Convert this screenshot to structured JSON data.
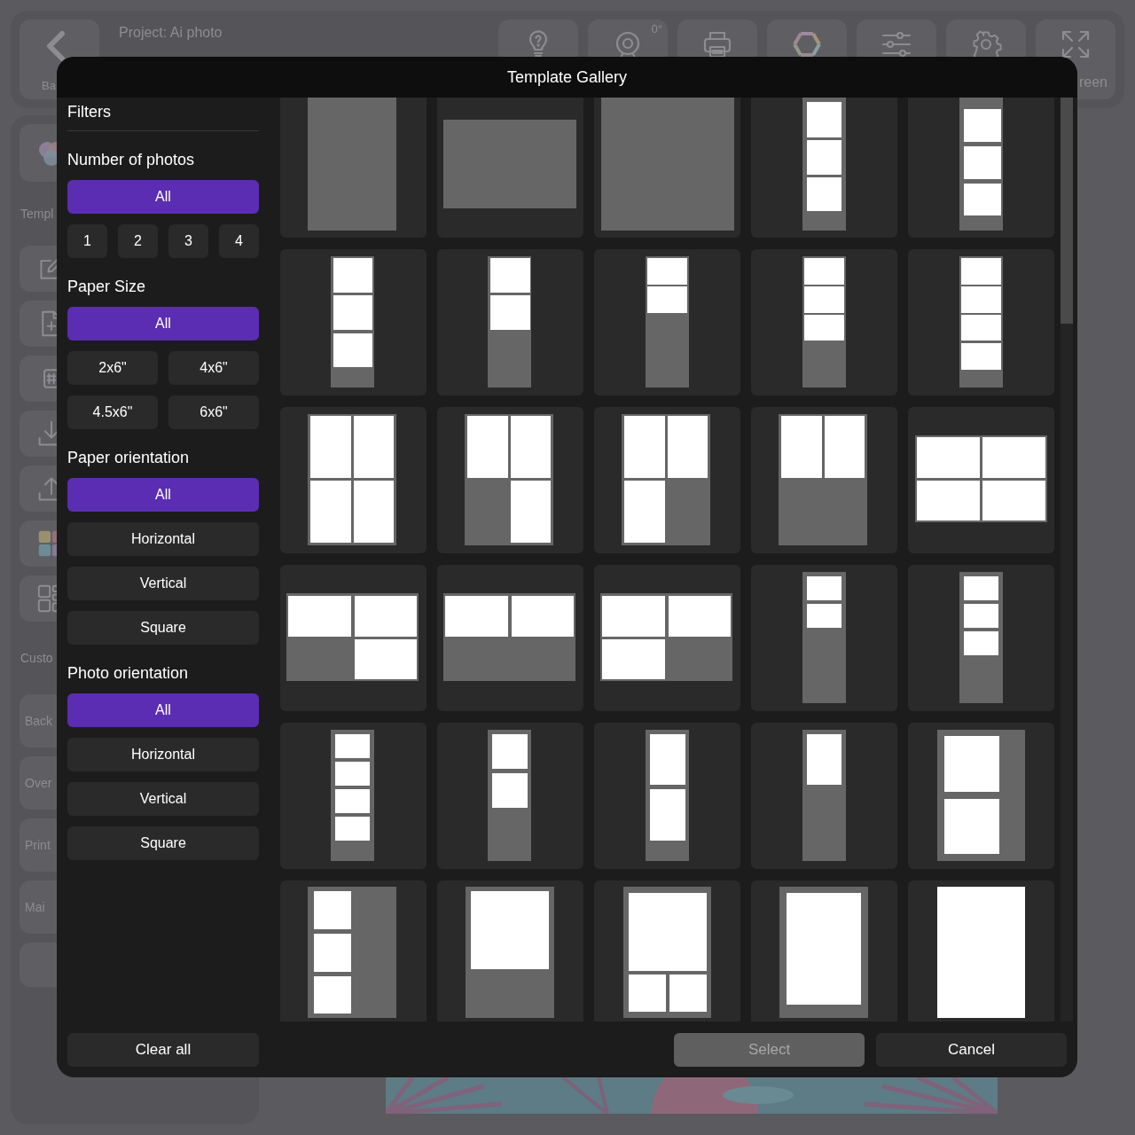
{
  "app": {
    "back_label": "Ba",
    "project_label": "Project: Ai photo",
    "toolbar": [
      {
        "kind": "help"
      },
      {
        "kind": "camera",
        "badge": "0°"
      },
      {
        "kind": "printer"
      },
      {
        "kind": "palette"
      },
      {
        "kind": "adjust"
      },
      {
        "kind": "settings"
      },
      {
        "kind": "fullscreen",
        "label": "reen"
      }
    ],
    "sidebar": [
      {
        "kind": "logo"
      },
      {
        "kind": "heading",
        "label": "Templ"
      },
      {
        "kind": "edit"
      },
      {
        "kind": "add-file"
      },
      {
        "kind": "small-grid"
      },
      {
        "kind": "download"
      },
      {
        "kind": "upload"
      },
      {
        "kind": "color-grid"
      },
      {
        "kind": "layout-grid"
      },
      {
        "kind": "heading",
        "label": "Custo"
      },
      {
        "kind": "button",
        "label": "Back"
      },
      {
        "kind": "button",
        "label": "Over"
      },
      {
        "kind": "button",
        "label": "Print"
      },
      {
        "kind": "button",
        "label": "Mai"
      },
      {
        "kind": "blank"
      }
    ]
  },
  "dialog": {
    "title": "Template Gallery",
    "filters": {
      "title": "Filters",
      "groups": [
        {
          "label": "Number of photos",
          "options": [
            {
              "label": "All",
              "selected": true
            },
            {
              "label": "1",
              "selected": false
            },
            {
              "label": "2",
              "selected": false
            },
            {
              "label": "3",
              "selected": false
            },
            {
              "label": "4",
              "selected": false
            }
          ]
        },
        {
          "label": "Paper Size",
          "options": [
            {
              "label": "All",
              "selected": true
            },
            {
              "label": "2x6\"",
              "selected": false
            },
            {
              "label": "4x6\"",
              "selected": false
            },
            {
              "label": "4.5x6\"",
              "selected": false
            },
            {
              "label": "6x6\"",
              "selected": false
            }
          ]
        },
        {
          "label": "Paper orientation",
          "options": [
            {
              "label": "All",
              "selected": true
            },
            {
              "label": "Horizontal",
              "selected": false
            },
            {
              "label": "Vertical",
              "selected": false
            },
            {
              "label": "Square",
              "selected": false
            }
          ]
        },
        {
          "label": "Photo orientation",
          "options": [
            {
              "label": "All",
              "selected": true
            },
            {
              "label": "Horizontal",
              "selected": false
            },
            {
              "label": "Vertical",
              "selected": false
            },
            {
              "label": "Square",
              "selected": false
            }
          ]
        }
      ]
    },
    "templates": [
      {
        "kind": "portrait-blank"
      },
      {
        "kind": "landscape-blank"
      },
      {
        "kind": "square-blank"
      },
      {
        "kind": "strip-3-tall"
      },
      {
        "kind": "strip-3-low"
      },
      {
        "kind": "strip-3"
      },
      {
        "kind": "strip-2"
      },
      {
        "kind": "strip-2-short"
      },
      {
        "kind": "strip-3-short"
      },
      {
        "kind": "strip-4-short"
      },
      {
        "kind": "grid-4"
      },
      {
        "kind": "grid-3-br"
      },
      {
        "kind": "grid-3-bl"
      },
      {
        "kind": "grid-2-top"
      },
      {
        "kind": "landscape-grid-4"
      },
      {
        "kind": "landscape-3-br"
      },
      {
        "kind": "landscape-2-top"
      },
      {
        "kind": "landscape-3-bl"
      },
      {
        "kind": "strip-2-mini"
      },
      {
        "kind": "strip-3-mini"
      },
      {
        "kind": "strip-4-mini"
      },
      {
        "kind": "strip-2-med"
      },
      {
        "kind": "strip-2-tall"
      },
      {
        "kind": "strip-1"
      },
      {
        "kind": "portrait-2"
      },
      {
        "kind": "portrait-3-left"
      },
      {
        "kind": "portrait-1-top"
      },
      {
        "kind": "portrait-1-2"
      },
      {
        "kind": "portrait-1-large"
      },
      {
        "kind": "portrait-full"
      }
    ],
    "footer": {
      "clear_label": "Clear all",
      "select": {
        "label": "Select",
        "disabled": true
      },
      "cancel_label": "Cancel"
    }
  }
}
